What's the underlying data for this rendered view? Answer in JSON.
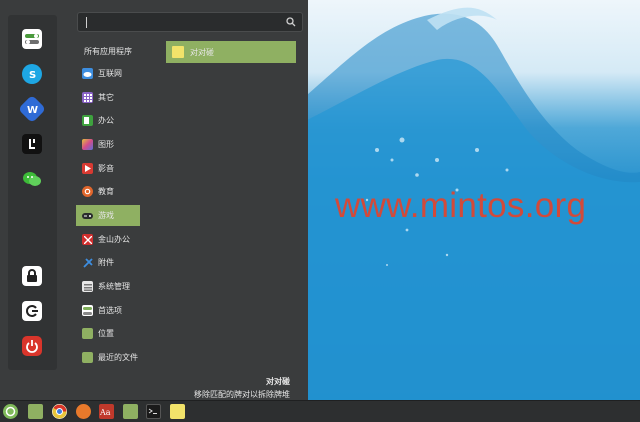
{
  "wallpaper": {
    "watermark": "www.mintos.org"
  },
  "menu": {
    "search": {
      "value": "",
      "placeholder": ""
    },
    "favorites": [
      {
        "name": "settings-toggle-icon",
        "color": "#4a9a3c"
      },
      {
        "name": "skype-icon",
        "color": "#1ea7e4"
      },
      {
        "name": "wps-icon",
        "color": "#2f6bd6"
      },
      {
        "name": "lark-icon",
        "color": "#111111"
      },
      {
        "name": "wechat-icon",
        "color": "#3dbb38"
      },
      {
        "name": "lock-icon",
        "color": "#222222"
      },
      {
        "name": "logout-icon",
        "color": "#222222"
      },
      {
        "name": "power-icon",
        "color": "#d9352b"
      }
    ],
    "categories_header": "所有应用程序",
    "categories": [
      {
        "label": "互联网",
        "icon": "cloud-icon",
        "color": "#3d8ee0"
      },
      {
        "label": "其它",
        "icon": "grid-icon",
        "color": "#8a63c7"
      },
      {
        "label": "办公",
        "icon": "office-icon",
        "color": "#3ea23e"
      },
      {
        "label": "图形",
        "icon": "graphics-icon",
        "color": "#d44c8a"
      },
      {
        "label": "影音",
        "icon": "media-icon",
        "color": "#d83a32"
      },
      {
        "label": "教育",
        "icon": "education-icon",
        "color": "#e0662c"
      },
      {
        "label": "游戏",
        "icon": "gamepad-icon",
        "color": "#3a3c3d"
      },
      {
        "label": "金山办公",
        "icon": "wps-office-icon",
        "color": "#cf2f2f"
      },
      {
        "label": "附件",
        "icon": "accessories-icon",
        "color": "#3d8ee0"
      },
      {
        "label": "系统管理",
        "icon": "system-icon",
        "color": "#a0a0a0"
      },
      {
        "label": "首选项",
        "icon": "preferences-icon",
        "color": "#7fae5a"
      },
      {
        "label": "位置",
        "icon": "folder-icon",
        "color": "#8fb062"
      },
      {
        "label": "最近的文件",
        "icon": "recent-folder-icon",
        "color": "#8fb062"
      }
    ],
    "active_category": "游戏",
    "apps": [
      {
        "label": "对对碰",
        "icon": "game-app-icon"
      }
    ],
    "description": {
      "title": "对对碰",
      "text": "移除匹配的牌对以拆除牌堆"
    },
    "colors": {
      "accent": "#8fb062",
      "panel": "#3a3c3d"
    }
  },
  "taskbar": {
    "items": [
      {
        "name": "mint-menu-icon",
        "color": "#7fb95a"
      },
      {
        "name": "show-desktop-icon",
        "color": "#8fb062"
      },
      {
        "name": "chrome-icon",
        "color": "#e8c53a"
      },
      {
        "name": "firefox-icon",
        "color": "#e8792b"
      },
      {
        "name": "dictionary-icon",
        "color": "#c0392b"
      },
      {
        "name": "files-icon",
        "color": "#8fb062"
      },
      {
        "name": "terminal-icon",
        "color": "#1a1a1a"
      },
      {
        "name": "game-app-icon",
        "color": "#f2e36a"
      }
    ]
  }
}
